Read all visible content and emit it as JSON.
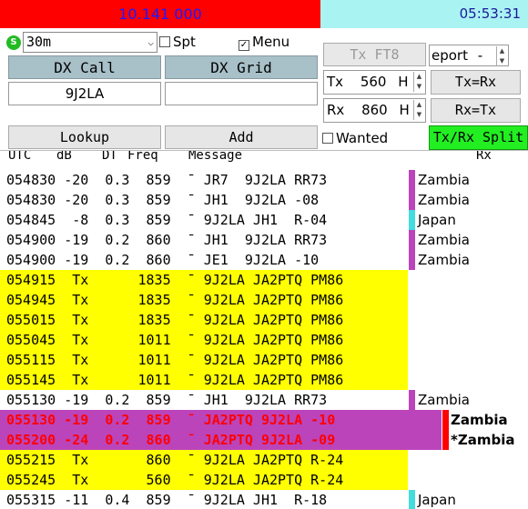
{
  "header": {
    "dial_freq": "10.141 000",
    "clock": "05:53:31"
  },
  "controls": {
    "band": "30m",
    "spot_label": "Spt",
    "menu_label": "Menu",
    "menu_checked": "✓",
    "dx_call_label": "DX Call",
    "dx_grid_label": "DX Grid",
    "dx_call_value": "9J2LA",
    "dx_grid_value": "",
    "tx_mode_label": "Tx FT8",
    "report_label": "eport",
    "report_value": "-",
    "tx_prefix": "Tx",
    "tx_value": "560",
    "rx_prefix": "Rx",
    "rx_value": "860",
    "hz_unit": "H",
    "tx_eq_rx": "Tx=Rx",
    "rx_eq_tx": "Rx=Tx",
    "lookup": "Lookup",
    "add": "Add",
    "wanted": "Wanted",
    "split": "Tx/Rx Split"
  },
  "columns": {
    "utc": "UTC",
    "db": "dB",
    "dt": "DT",
    "freq": "Freq",
    "message": "Message",
    "rx_freq": "Rx Freq"
  },
  "rows": [
    {
      "text": "054830 -20  0.3  859  ̄  JR7  9J2LA RR73",
      "country": "Zambia"
    },
    {
      "text": "054830 -20  0.3  859  ̄  JH1  9J2LA -08",
      "country": "Zambia"
    },
    {
      "text": "054845  -8  0.3  859  ̄  9J2LA JH1  R-04",
      "country": "Japan"
    },
    {
      "text": "054900 -19  0.2  860  ̄  JH1  9J2LA RR73",
      "country": "Zambia"
    },
    {
      "text": "054900 -19  0.2  860  ̄  JE1  9J2LA -10",
      "country": "Zambia"
    },
    {
      "text": "054915  Tx      1835  ̄  9J2LA JA2PTQ PM86",
      "country": ""
    },
    {
      "text": "054945  Tx      1835  ̄  9J2LA JA2PTQ PM86",
      "country": ""
    },
    {
      "text": "055015  Tx      1835  ̄  9J2LA JA2PTQ PM86",
      "country": ""
    },
    {
      "text": "055045  Tx      1011  ̄  9J2LA JA2PTQ PM86",
      "country": ""
    },
    {
      "text": "055115  Tx      1011  ̄  9J2LA JA2PTQ PM86",
      "country": ""
    },
    {
      "text": "055145  Tx      1011  ̄  9J2LA JA2PTQ PM86",
      "country": ""
    },
    {
      "text": "055130 -19  0.2  859  ̄  JH1  9J2LA RR73",
      "country": "Zambia"
    },
    {
      "text": "055130 -19  0.2  859  ̄  JA2PTQ 9J2LA -10",
      "country": "Zambia"
    },
    {
      "text": "055200 -24  0.2  860  ̄  JA2PTQ 9J2LA -09",
      "country": "*Zambia"
    },
    {
      "text": "055215  Tx       860  ̄  9J2LA JA2PTQ R-24",
      "country": ""
    },
    {
      "text": "055245  Tx       560  ̄  9J2LA JA2PTQ R-24",
      "country": ""
    },
    {
      "text": "055315 -11  0.4  859  ̄  9J2LA JH1  R-18",
      "country": "Japan"
    }
  ],
  "colors": {
    "freq_bg": "#ff0000",
    "clock_bg": "#aaf3f3",
    "tx_row": "#ffff00",
    "to_me_row": "#bb44bb",
    "zambia_marker": "#bb44bb",
    "japan_marker": "#44dddd",
    "split_bg": "#22ee22",
    "button_gray": "#a8c0c8"
  }
}
